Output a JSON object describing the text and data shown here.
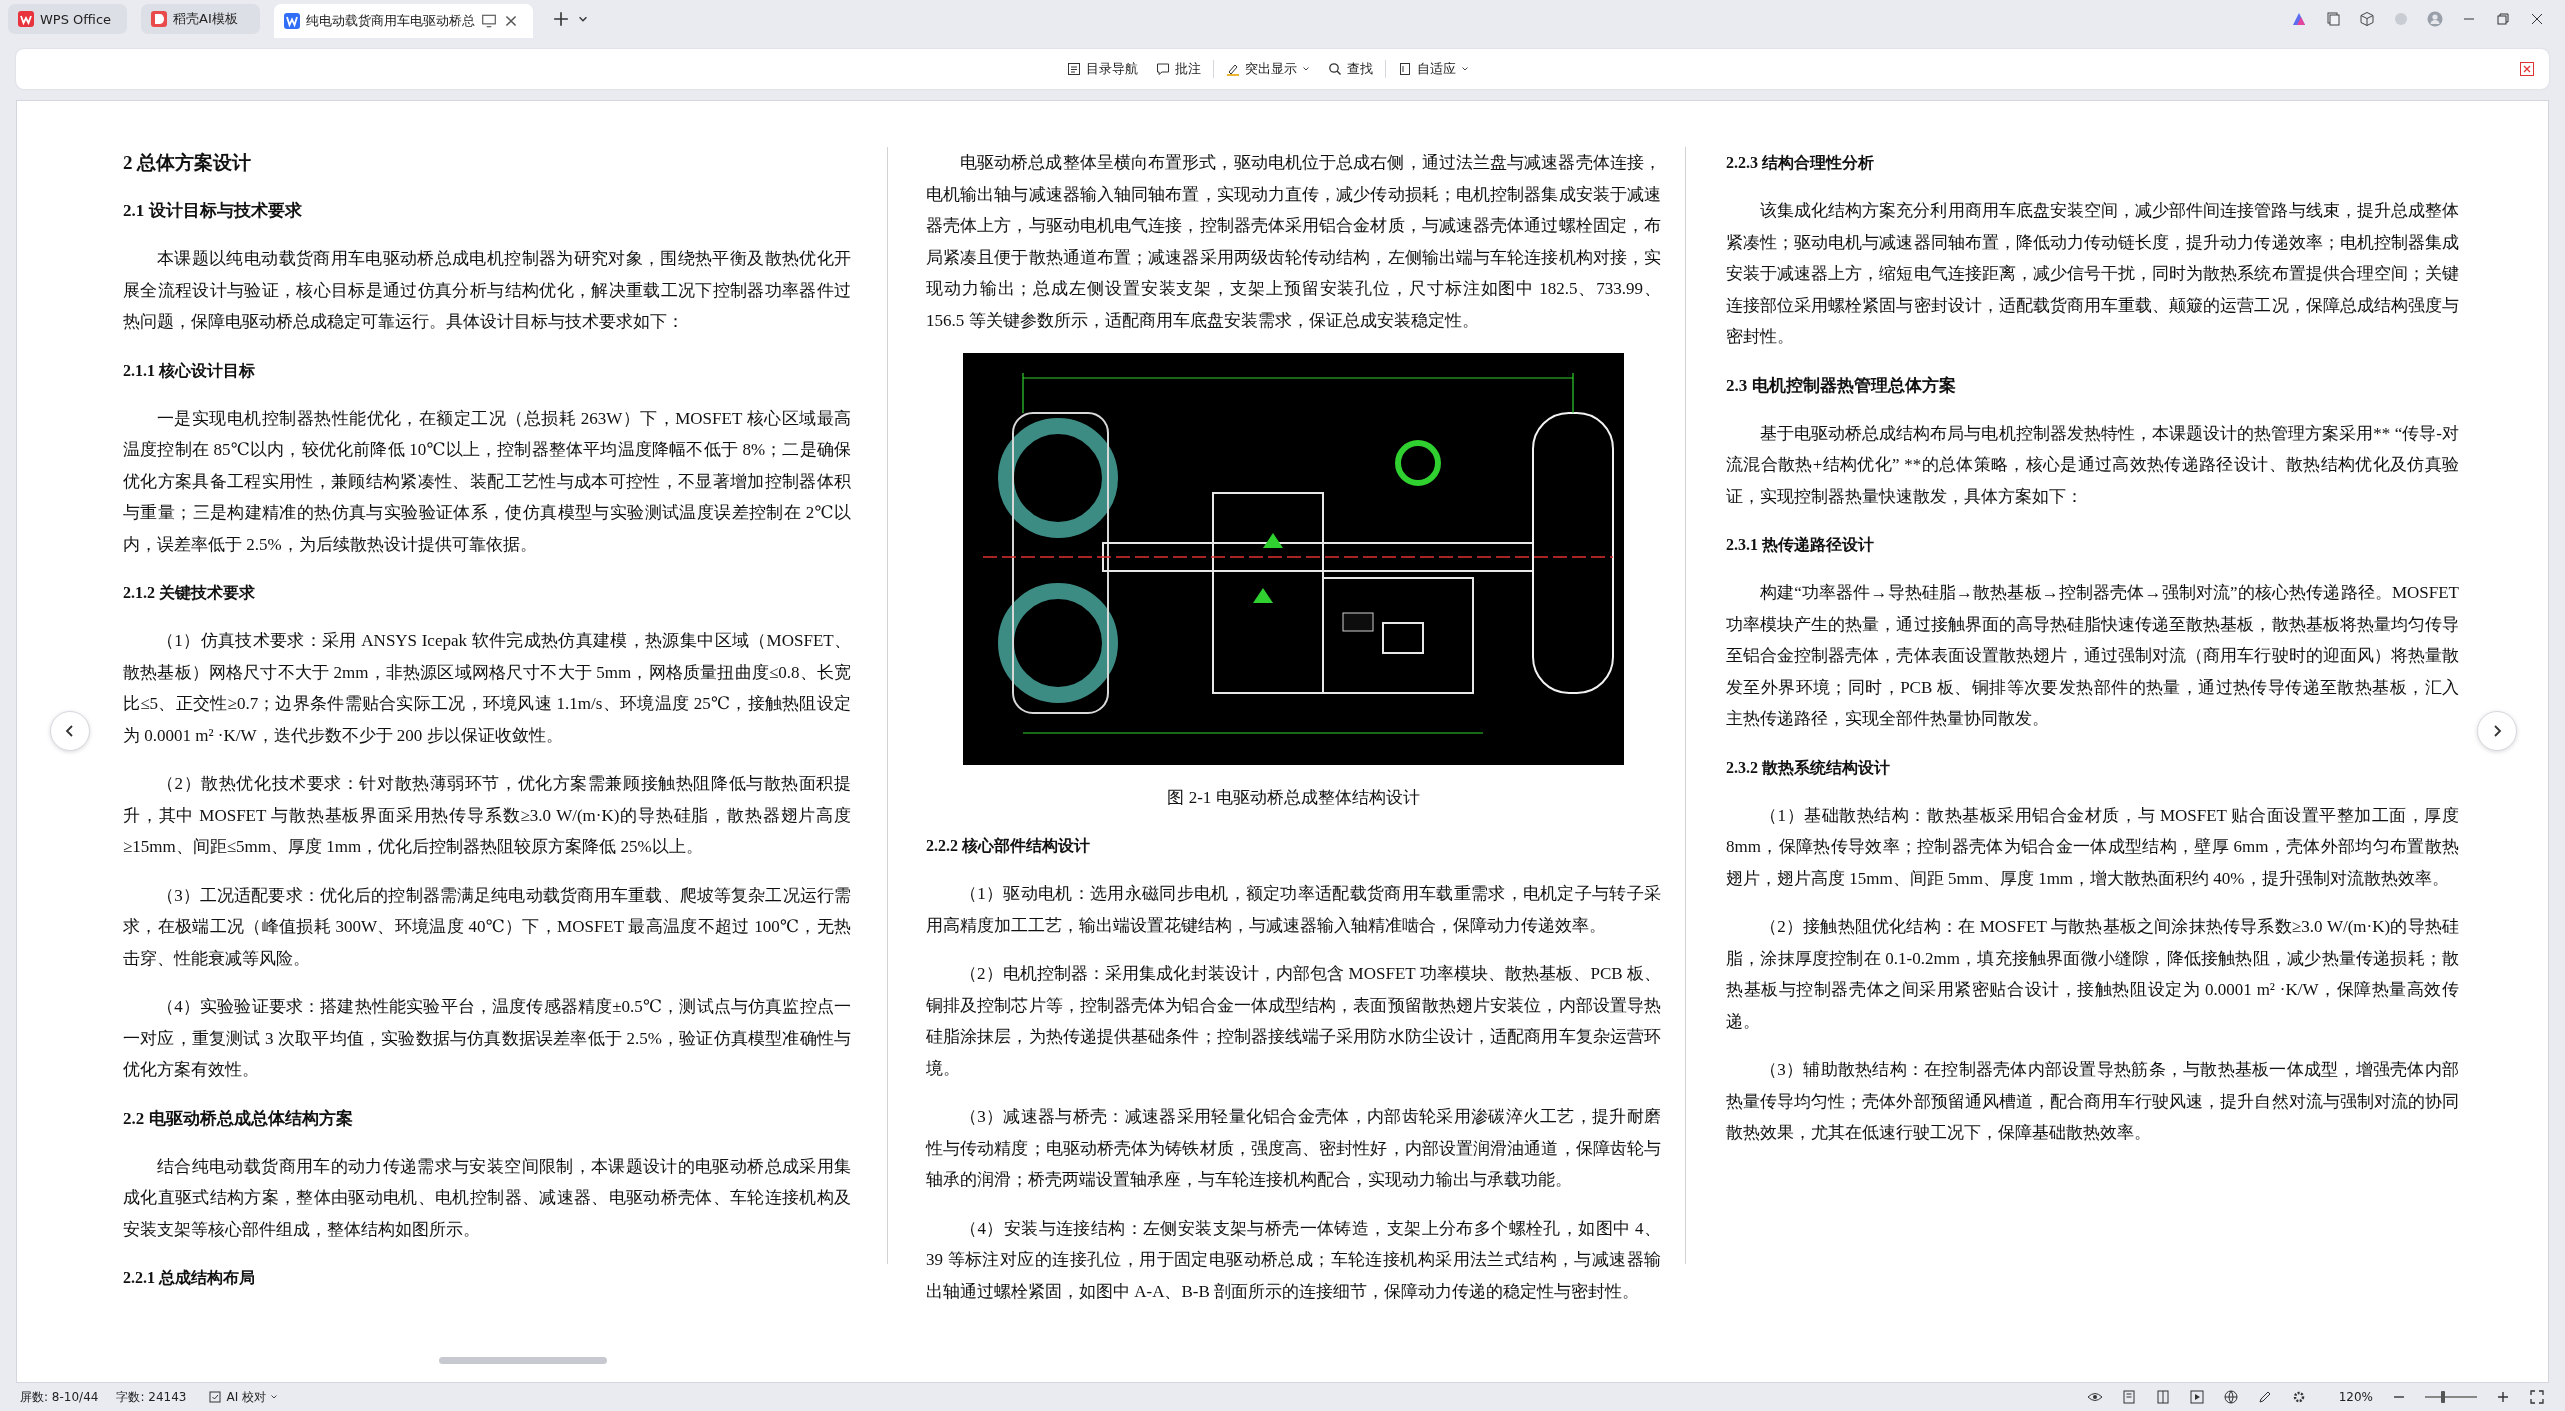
{
  "tabs": [
    {
      "label": "WPS Office",
      "selected": false,
      "closable": false
    },
    {
      "label": "稻壳AI模板",
      "selected": false,
      "closable": false
    },
    {
      "label": "纯电动载货商用车电驱动桥总",
      "selected": true,
      "closable": true
    }
  ],
  "toolbar": {
    "items": [
      {
        "label": "目录导航",
        "has_menu": false
      },
      {
        "label": "批注",
        "has_menu": false
      },
      {
        "label": "突出显示",
        "has_menu": true
      },
      {
        "label": "查找",
        "has_menu": false
      },
      {
        "label": "自适应",
        "has_menu": true
      }
    ]
  },
  "document": {
    "columns": [
      {
        "blocks": [
          {
            "kind": "h1",
            "text": "2  总体方案设计"
          },
          {
            "kind": "h2",
            "text": "2.1  设计目标与技术要求"
          },
          {
            "kind": "para",
            "text": "本课题以纯电动载货商用车电驱动桥总成电机控制器为研究对象，围绕热平衡及散热优化开展全流程设计与验证，核心目标是通过仿真分析与结构优化，解决重载工况下控制器功率器件过热问题，保障电驱动桥总成稳定可靠运行。具体设计目标与技术要求如下："
          },
          {
            "kind": "h3",
            "text": "2.1.1  核心设计目标"
          },
          {
            "kind": "para",
            "text": "一是实现电机控制器热性能优化，在额定工况（总损耗 263W）下，MOSFET 核心区域最高温度控制在 85℃以内，较优化前降低 10℃以上，控制器整体平均温度降幅不低于 8%；二是确保优化方案具备工程实用性，兼顾结构紧凑性、装配工艺性与成本可控性，不显著增加控制器体积与重量；三是构建精准的热仿真与实验验证体系，使仿真模型与实验测试温度误差控制在 2℃以内，误差率低于 2.5%，为后续散热设计提供可靠依据。"
          },
          {
            "kind": "h3",
            "text": "2.1.2  关键技术要求"
          },
          {
            "kind": "para",
            "text": "（1）仿真技术要求：采用 ANSYS Icepak 软件完成热仿真建模，热源集中区域（MOSFET、散热基板）网格尺寸不大于 2mm，非热源区域网格尺寸不大于 5mm，网格质量扭曲度≤0.8、长宽比≤5、正交性≥0.7；边界条件需贴合实际工况，环境风速 1.1m/s、环境温度 25℃，接触热阻设定为 0.0001 m² ·K/W，迭代步数不少于 200 步以保证收敛性。"
          },
          {
            "kind": "para",
            "text": "（2）散热优化技术要求：针对散热薄弱环节，优化方案需兼顾接触热阻降低与散热面积提升，其中 MOSFET 与散热基板界面采用热传导系数≥3.0 W/(m·K)的导热硅脂，散热器翅片高度≥15mm、间距≤5mm、厚度 1mm，优化后控制器热阻较原方案降低 25%以上。"
          },
          {
            "kind": "para",
            "text": "（3）工况适配要求：优化后的控制器需满足纯电动载货商用车重载、爬坡等复杂工况运行需求，在极端工况（峰值损耗 300W、环境温度 40℃）下，MOSFET 最高温度不超过 100℃，无热击穿、性能衰减等风险。"
          },
          {
            "kind": "para",
            "text": "（4）实验验证要求：搭建热性能实验平台，温度传感器精度±0.5℃，测试点与仿真监控点一一对应，重复测试 3 次取平均值，实验数据与仿真数据误差率低于 2.5%，验证仿真模型准确性与优化方案有效性。"
          },
          {
            "kind": "h2",
            "text": "2.2  电驱动桥总成总体结构方案"
          },
          {
            "kind": "para",
            "text": "结合纯电动载货商用车的动力传递需求与安装空间限制，本课题设计的电驱动桥总成采用集成化直驱式结构方案，整体由驱动电机、电机控制器、减速器、电驱动桥壳体、车轮连接机构及安装支架等核心部件组成，整体结构如图所示。"
          },
          {
            "kind": "h3",
            "text": "2.2.1  总成结构布局"
          }
        ]
      },
      {
        "blocks": [
          {
            "kind": "para",
            "text": "电驱动桥总成整体呈横向布置形式，驱动电机位于总成右侧，通过法兰盘与减速器壳体连接，电机输出轴与减速器输入轴同轴布置，实现动力直传，减少传动损耗；电机控制器集成安装于减速器壳体上方，与驱动电机电气连接，控制器壳体采用铝合金材质，与减速器壳体通过螺栓固定，布局紧凑且便于散热通道布置；减速器采用两级齿轮传动结构，左侧输出端与车轮连接机构对接，实现动力输出；总成左侧设置安装支架，支架上预留安装孔位，尺寸标注如图中 182.5、733.99、156.5 等关键参数所示，适配商用车底盘安装需求，保证总成安装稳定性。"
          },
          {
            "kind": "picture"
          },
          {
            "kind": "caption",
            "text": "图 2-1  电驱动桥总成整体结构设计"
          },
          {
            "kind": "h3",
            "text": "2.2.2  核心部件结构设计"
          },
          {
            "kind": "para",
            "text": "（1）驱动电机：选用永磁同步电机，额定功率适配载货商用车载重需求，电机定子与转子采用高精度加工工艺，输出端设置花键结构，与减速器输入轴精准啮合，保障动力传递效率。"
          },
          {
            "kind": "para",
            "text": "（2）电机控制器：采用集成化封装设计，内部包含 MOSFET 功率模块、散热基板、PCB 板、铜排及控制芯片等，控制器壳体为铝合金一体成型结构，表面预留散热翅片安装位，内部设置导热硅脂涂抹层，为热传递提供基础条件；控制器接线端子采用防水防尘设计，适配商用车复杂运营环境。"
          },
          {
            "kind": "para",
            "text": "（3）减速器与桥壳：减速器采用轻量化铝合金壳体，内部齿轮采用渗碳淬火工艺，提升耐磨性与传动精度；电驱动桥壳体为铸铁材质，强度高、密封性好，内部设置润滑油通道，保障齿轮与轴承的润滑；桥壳两端设置轴承座，与车轮连接机构配合，实现动力输出与承载功能。"
          },
          {
            "kind": "para",
            "text": "（4）安装与连接结构：左侧安装支架与桥壳一体铸造，支架上分布多个螺栓孔，如图中 4、39 等标注对应的连接孔位，用于固定电驱动桥总成；车轮连接机构采用法兰式结构，与减速器输出轴通过螺栓紧固，如图中 A-A、B-B 剖面所示的连接细节，保障动力传递的稳定性与密封性。"
          }
        ]
      },
      {
        "blocks": [
          {
            "kind": "h3",
            "text": "2.2.3  结构合理性分析"
          },
          {
            "kind": "para",
            "text": "该集成化结构方案充分利用商用车底盘安装空间，减少部件间连接管路与线束，提升总成整体紧凑性；驱动电机与减速器同轴布置，降低动力传动链长度，提升动力传递效率；电机控制器集成安装于减速器上方，缩短电气连接距离，减少信号干扰，同时为散热系统布置提供合理空间；关键连接部位采用螺栓紧固与密封设计，适配载货商用车重载、颠簸的运营工况，保障总成结构强度与密封性。"
          },
          {
            "kind": "h2",
            "text": "2.3  电机控制器热管理总体方案"
          },
          {
            "kind": "para",
            "text": "基于电驱动桥总成结构布局与电机控制器发热特性，本课题设计的热管理方案采用** “传导-对流混合散热+结构优化” **的总体策略，核心是通过高效热传递路径设计、散热结构优化及仿真验证，实现控制器热量快速散发，具体方案如下："
          },
          {
            "kind": "h3",
            "text": "2.3.1  热传递路径设计"
          },
          {
            "kind": "para",
            "text": "构建“功率器件→导热硅脂→散热基板→控制器壳体→强制对流”的核心热传递路径。MOSFET 功率模块产生的热量，通过接触界面的高导热硅脂快速传递至散热基板，散热基板将热量均匀传导至铝合金控制器壳体，壳体表面设置散热翅片，通过强制对流（商用车行驶时的迎面风）将热量散发至外界环境；同时，PCB 板、铜排等次要发热部件的热量，通过热传导传递至散热基板，汇入主热传递路径，实现全部件热量协同散发。"
          },
          {
            "kind": "h3",
            "text": "2.3.2  散热系统结构设计"
          },
          {
            "kind": "para",
            "text": "（1）基础散热结构：散热基板采用铝合金材质，与 MOSFET 贴合面设置平整加工面，厚度 8mm，保障热传导效率；控制器壳体为铝合金一体成型结构，壁厚 6mm，壳体外部均匀布置散热翅片，翅片高度 15mm、间距 5mm、厚度 1mm，增大散热面积约 40%，提升强制对流散热效率。"
          },
          {
            "kind": "para",
            "text": "（2）接触热阻优化结构：在 MOSFET 与散热基板之间涂抹热传导系数≥3.0 W/(m·K)的导热硅脂，涂抹厚度控制在 0.1-0.2mm，填充接触界面微小缝隙，降低接触热阻，减少热量传递损耗；散热基板与控制器壳体之间采用紧密贴合设计，接触热阻设定为 0.0001 m² ·K/W，保障热量高效传递。"
          },
          {
            "kind": "para",
            "text": "（3）辅助散热结构：在控制器壳体内部设置导热筋条，与散热基板一体成型，增强壳体内部热量传导均匀性；壳体外部预留通风槽道，配合商用车行驶风速，提升自然对流与强制对流的协同散热效果，尤其在低速行驶工况下，保障基础散热效率。"
          }
        ]
      }
    ]
  },
  "status_bar": {
    "screens": "屏数: 8-10/44",
    "word_count": "字数: 24143",
    "ai_check": "AI 校对",
    "zoom": "120%",
    "zoom_slider": {
      "level": 0.35
    }
  }
}
